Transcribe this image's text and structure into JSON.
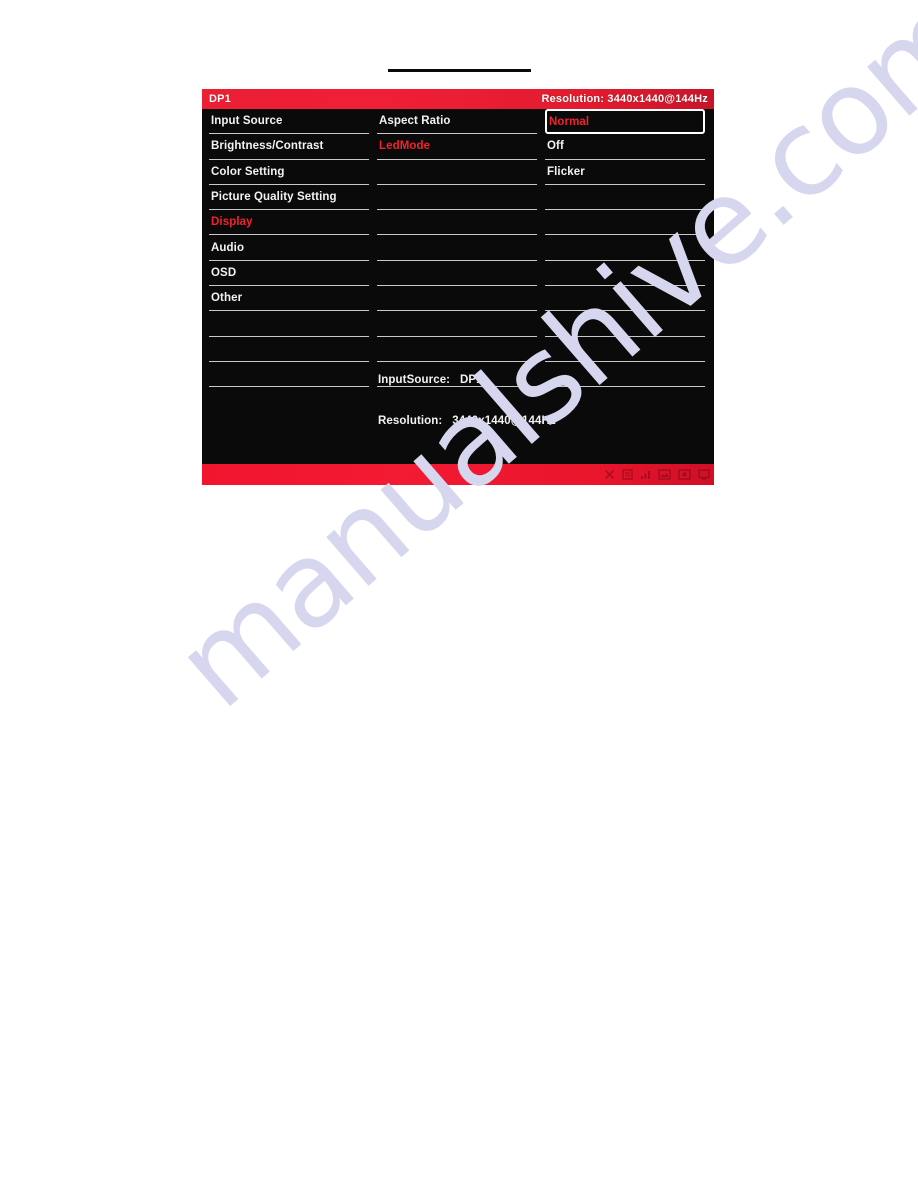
{
  "page": {
    "background": "#ffffff",
    "watermark_text": "manualshive.com",
    "watermark_color": "#d6d6ef"
  },
  "osd": {
    "accent_red": "#ec1f33",
    "highlight_red": "#f0232f",
    "panel_background": "#0b0a0a",
    "divider_color": "#c9c9c9",
    "header": {
      "input_label": "DP1",
      "resolution_label": "Resolution:  3440x1440@144Hz"
    },
    "columns": [
      {
        "name": "main-menu",
        "rows": [
          {
            "label": "Input Source",
            "state": "normal"
          },
          {
            "label": "Brightness/Contrast",
            "state": "normal"
          },
          {
            "label": "Color Setting",
            "state": "normal"
          },
          {
            "label": "Picture Quality Setting",
            "state": "normal"
          },
          {
            "label": "Display",
            "state": "active"
          },
          {
            "label": "Audio",
            "state": "normal"
          },
          {
            "label": "OSD",
            "state": "normal"
          },
          {
            "label": "Other",
            "state": "normal"
          },
          {
            "label": "",
            "state": "blank"
          },
          {
            "label": "",
            "state": "blank"
          },
          {
            "label": "",
            "state": "blank"
          },
          {
            "label": "",
            "state": "blank"
          }
        ]
      },
      {
        "name": "submenu",
        "rows": [
          {
            "label": "Aspect Ratio",
            "state": "normal"
          },
          {
            "label": "LedMode",
            "state": "active"
          },
          {
            "label": "",
            "state": "blank"
          },
          {
            "label": "",
            "state": "blank"
          },
          {
            "label": "",
            "state": "blank"
          },
          {
            "label": "",
            "state": "blank"
          },
          {
            "label": "",
            "state": "blank"
          },
          {
            "label": "",
            "state": "blank"
          },
          {
            "label": "",
            "state": "blank"
          },
          {
            "label": "",
            "state": "blank"
          },
          {
            "label": "",
            "state": "blank"
          },
          {
            "label": "",
            "state": "blank"
          }
        ]
      },
      {
        "name": "values",
        "rows": [
          {
            "label": "Normal",
            "state": "selected"
          },
          {
            "label": "Off",
            "state": "normal"
          },
          {
            "label": "Flicker",
            "state": "normal"
          },
          {
            "label": "",
            "state": "blank"
          },
          {
            "label": "",
            "state": "blank"
          },
          {
            "label": "",
            "state": "blank"
          },
          {
            "label": "",
            "state": "blank"
          },
          {
            "label": "",
            "state": "blank"
          },
          {
            "label": "",
            "state": "blank"
          },
          {
            "label": "",
            "state": "blank"
          },
          {
            "label": "",
            "state": "blank"
          },
          {
            "label": "",
            "state": "blank"
          }
        ]
      }
    ],
    "status": {
      "input_source_line": "InputSource:   DP1",
      "resolution_line": "Resolution:   3440x1440@144Hz"
    },
    "footer": {
      "icons": [
        "close-icon",
        "menu-icon",
        "signal-icon",
        "image-icon",
        "picture-icon",
        "display-icon"
      ]
    }
  }
}
